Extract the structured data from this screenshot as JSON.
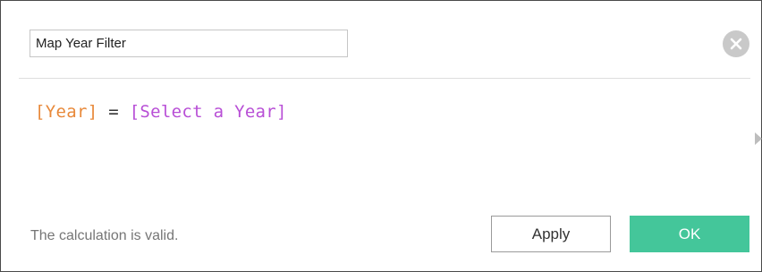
{
  "dialog": {
    "name_value": "Map Year Filter",
    "close_icon": "close-circle-icon",
    "formula": {
      "field": "[Year]",
      "operator": "=",
      "parameter": "[Select a Year]"
    },
    "status_text": "The calculation is valid.",
    "apply_label": "Apply",
    "ok_label": "OK"
  },
  "colors": {
    "field": "#e8893a",
    "parameter": "#b84fd6",
    "ok_button": "#44c69a"
  }
}
